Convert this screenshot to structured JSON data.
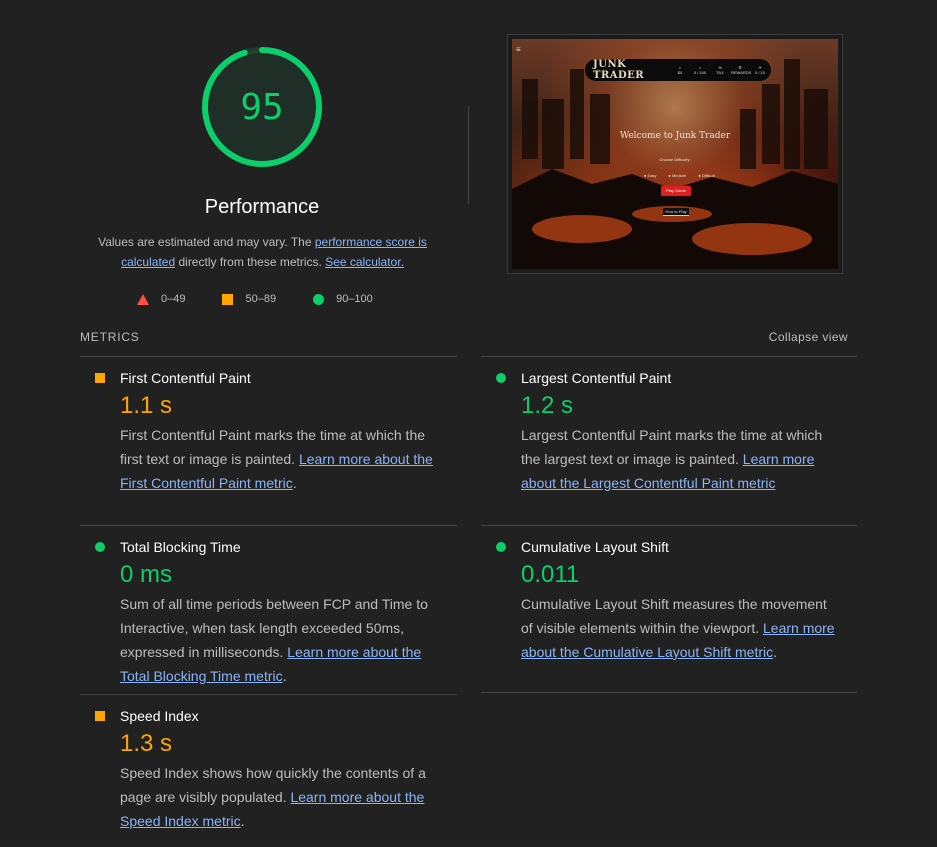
{
  "summary": {
    "score": "95",
    "category_title": "Performance",
    "desc_prefix": "Values are estimated and may vary. The ",
    "desc_link1": "performance score is calculated",
    "desc_middle": " directly from these metrics. ",
    "desc_link2": "See calculator.",
    "score_fraction": 0.95,
    "score_color": "#0cce6b"
  },
  "legend": [
    {
      "icon": "triangle-fail-icon",
      "label": "0–49",
      "color": "#ff4e42"
    },
    {
      "icon": "square-average-icon",
      "label": "50–89",
      "color": "#ffa400"
    },
    {
      "icon": "circle-pass-icon",
      "label": "90–100",
      "color": "#0cce6b"
    }
  ],
  "thumbnail": {
    "menu_glyph": "≡",
    "logo": "JUNK TRADER",
    "nav": [
      {
        "icon": "⌂",
        "label": "$0"
      },
      {
        "icon": "⌂",
        "label": "0 / 100"
      },
      {
        "icon": "%",
        "label": "TAX"
      },
      {
        "icon": "⚙",
        "label": "REWARDS"
      },
      {
        "icon": "✦",
        "label": "0 / 10"
      }
    ],
    "welcome": "Welcome to Junk Trader",
    "difficulty_label": "Choose Difficulty:",
    "difficulties": [
      "● Easy",
      "● Medium",
      "● Difficult"
    ],
    "play": "Play Game",
    "howto": "How to Play"
  },
  "metrics": {
    "header": "METRICS",
    "collapse": "Collapse view",
    "fcp": {
      "title": "First Contentful Paint",
      "value": "1.1 s",
      "desc": "First Contentful Paint marks the time at which the first text or image is painted. ",
      "link": "Learn more about the First Contentful Paint metric",
      "tail": "."
    },
    "lcp": {
      "title": "Largest Contentful Paint",
      "value": "1.2 s",
      "desc": "Largest Contentful Paint marks the time at which the largest text or image is painted. ",
      "link": "Learn more about the Largest Contentful Paint metric",
      "tail": ""
    },
    "tbt": {
      "title": "Total Blocking Time",
      "value": "0 ms",
      "desc": "Sum of all time periods between FCP and Time to Interactive, when task length exceeded 50ms, expressed in milliseconds. ",
      "link": "Learn more about the Total Blocking Time metric",
      "tail": "."
    },
    "cls": {
      "title": "Cumulative Layout Shift",
      "value": "0.011",
      "desc": "Cumulative Layout Shift measures the movement of visible elements within the viewport. ",
      "link": "Learn more about the Cumulative Layout Shift metric",
      "tail": "."
    },
    "si": {
      "title": "Speed Index",
      "value": "1.3 s",
      "desc": "Speed Index shows how quickly the contents of a page are visibly populated. ",
      "link": "Learn more about the Speed Index metric",
      "tail": "."
    }
  }
}
